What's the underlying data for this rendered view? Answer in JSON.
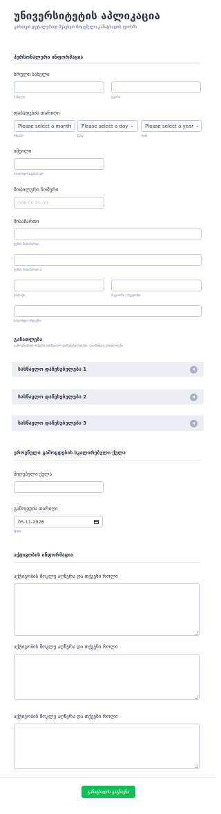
{
  "form": {
    "title": "უნივერსიტეტის აპლიკაცია",
    "subtitle": "გთხოვთ დეტალურად შეავსეთ მოცემული განაცხადის ფორმა"
  },
  "personal": {
    "section_title": "პერსონალური ინფორმაცია",
    "name": {
      "label": "სრული სახელი",
      "first_sublabel": "სახელი",
      "last_sublabel": "გვარი",
      "first_value": "",
      "last_value": ""
    },
    "birth": {
      "label": "დაბადების თარიღი",
      "month_value": "Please select a month",
      "day_value": "Please select a day",
      "year_value": "Please select a year",
      "month_sublabel": "Month",
      "day_sublabel": "Day",
      "year_sublabel": "Year"
    },
    "email": {
      "label": "იმეილი",
      "sublabel": "saxeli@magaliti.ge",
      "value": ""
    },
    "phone": {
      "label": "მობილური ნომერი",
      "placeholder": "000 00 00 00"
    },
    "address": {
      "label": "მისამართი",
      "street1_sublabel": "ქუჩის მისამართი",
      "street2_sublabel": "ქუჩის მისამართი 2",
      "city_sublabel": "ქალაქი",
      "region_sublabel": "რეგიონი / რეგიონი",
      "zip_sublabel": "საფოსტო ინდექსი"
    }
  },
  "education": {
    "section_title": "განათლება",
    "subtitle": "გამოგზავნეთ თქვენი სასწავლო დაწესებულებები. დაამატეთ ეპიდლოები.",
    "items": [
      {
        "label": "სასწავლო დაწესებულება 1"
      },
      {
        "label": "სასწავლო დაწესებულება 2"
      },
      {
        "label": "სასწავლო დაწესებულება 3"
      }
    ]
  },
  "exam": {
    "section_title": "ეროვნული გამოცდების სკალირებული ქულა",
    "score_label": "მიღებული ქულა",
    "score_value": "",
    "date_label": "გამოცდის თარიღი",
    "date_value": "05-11-2026",
    "date_sublabel": "Date"
  },
  "activity": {
    "section_title": "აქტივობის ინფორმაცია",
    "items": [
      {
        "label": "აქტივობის მოკლე აღწერა და თქვენი როლი"
      },
      {
        "label": "აქტივობის მოკლე აღწერა და თქვენი როლი"
      },
      {
        "label": "აქტივობის მოკლე აღწერა და თქვენი როლი"
      }
    ]
  },
  "submit": {
    "label": "განაცხადის გაგზავნა",
    "color": "#18bd5b"
  }
}
